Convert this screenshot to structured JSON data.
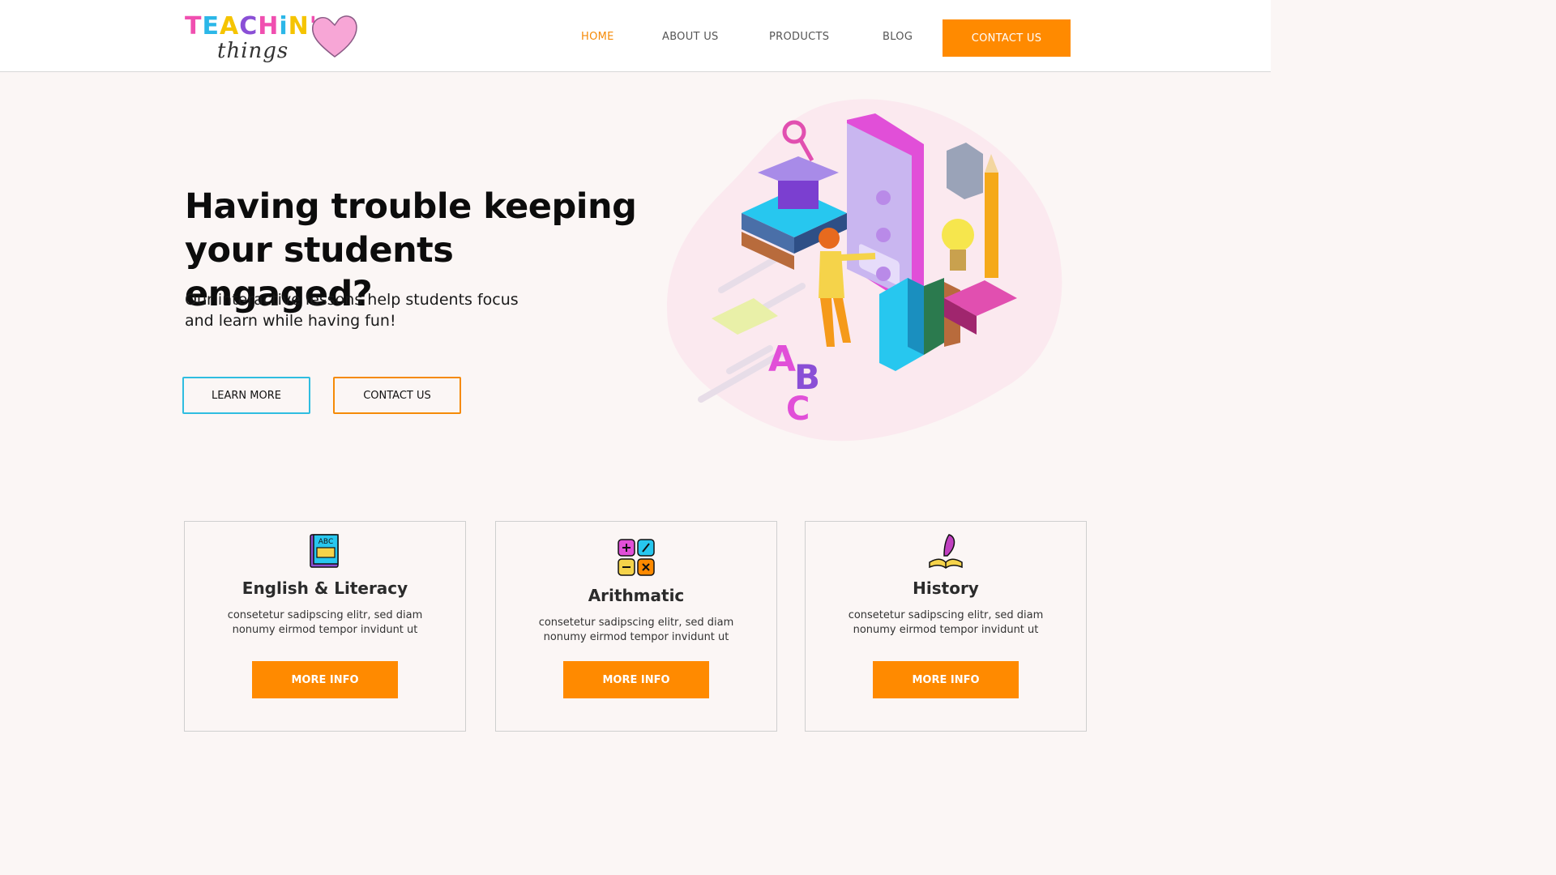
{
  "header": {
    "logo": {
      "word": "TEACHIN'",
      "sub": "things"
    },
    "nav": [
      {
        "label": "HOME"
      },
      {
        "label": "ABOUT US"
      },
      {
        "label": "PRODUCTS"
      },
      {
        "label": "BLOG"
      }
    ],
    "cta_label": "CONTACT US"
  },
  "hero": {
    "title": "Having trouble keeping your students engaged?",
    "subtitle": "Our interactive lessons help students focus and learn while having fun!",
    "learn_more_label": "LEARN MORE",
    "contact_label": "CONTACT US",
    "illustration_letters": [
      "A",
      "B",
      "C"
    ]
  },
  "cards": [
    {
      "icon": "abc-book-icon",
      "title": "English & Literacy",
      "text": "consetetur sadipscing elitr, sed diam nonumy eirmod tempor invidunt ut",
      "button": "MORE INFO"
    },
    {
      "icon": "calculator-symbols-icon",
      "title": "Arithmatic",
      "text": "consetetur sadipscing elitr, sed diam nonumy eirmod tempor invidunt ut",
      "button": "MORE INFO"
    },
    {
      "icon": "quill-book-icon",
      "title": "History",
      "text": "consetetur sadipscing elitr, sed diam nonumy eirmod tempor invidunt ut",
      "button": "MORE INFO"
    }
  ],
  "colors": {
    "accent": "#ff8a00",
    "secondary": "#2fbde0",
    "background": "#fbf6f5"
  }
}
